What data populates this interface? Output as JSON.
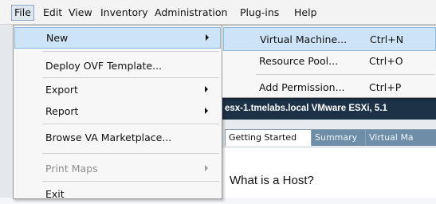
{
  "menubar": {
    "items": [
      "File",
      "Edit",
      "View",
      "Inventory",
      "Administration",
      "Plug-ins",
      "Help"
    ]
  },
  "file_menu": {
    "items": [
      {
        "label": "New",
        "submenu": true
      },
      {
        "label": "Deploy OVF Template..."
      },
      {
        "label": "Export",
        "submenu": true
      },
      {
        "label": "Report",
        "submenu": true
      },
      {
        "label": "Browse VA Marketplace..."
      },
      {
        "label": "Print Maps",
        "submenu": true,
        "disabled": true
      },
      {
        "label": "Exit"
      }
    ]
  },
  "new_submenu": {
    "items": [
      {
        "label": "Virtual Machine...",
        "shortcut": "Ctrl+N"
      },
      {
        "label": "Resource Pool...",
        "shortcut": "Ctrl+O"
      },
      {
        "label": "Add Permission...",
        "shortcut": "Ctrl+P"
      }
    ]
  },
  "host_panel": {
    "title": "esx-1.tmelabs.local VMware ESXi, 5.1",
    "tabs": [
      "Getting Started",
      "Summary",
      "Virtual Ma"
    ],
    "heading": "What is a Host?"
  }
}
